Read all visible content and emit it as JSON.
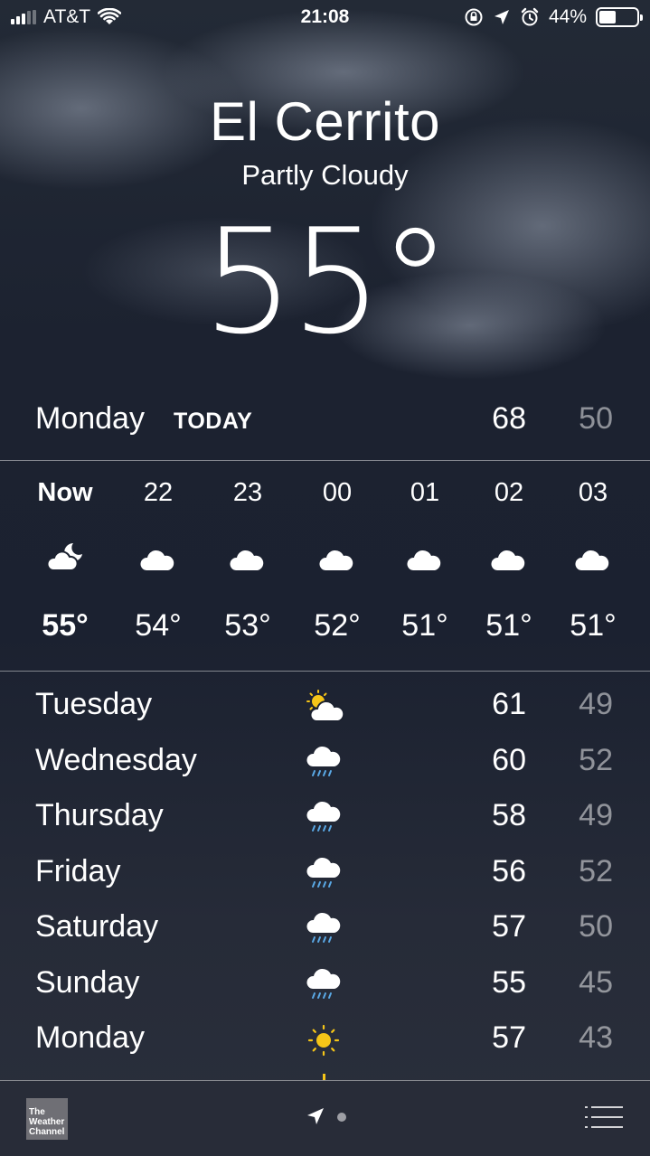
{
  "status": {
    "carrier": "AT&T",
    "time": "21:08",
    "battery": "44%",
    "battery_level": 0.44
  },
  "header": {
    "city": "El Cerrito",
    "condition": "Partly Cloudy",
    "temperature": "55°"
  },
  "today": {
    "day": "Monday",
    "tag": "TODAY",
    "high": "68",
    "low": "50"
  },
  "hourly": [
    {
      "hour": "Now",
      "icon": "partly-cloudy-night-icon",
      "temp": "55°"
    },
    {
      "hour": "22",
      "icon": "cloud-icon",
      "temp": "54°"
    },
    {
      "hour": "23",
      "icon": "cloud-icon",
      "temp": "53°"
    },
    {
      "hour": "00",
      "icon": "cloud-icon",
      "temp": "52°"
    },
    {
      "hour": "01",
      "icon": "cloud-icon",
      "temp": "51°"
    },
    {
      "hour": "02",
      "icon": "cloud-icon",
      "temp": "51°"
    },
    {
      "hour": "03",
      "icon": "cloud-icon",
      "temp": "51°"
    }
  ],
  "daily": [
    {
      "day": "Tuesday",
      "icon": "partly-sunny-icon",
      "high": "61",
      "low": "49"
    },
    {
      "day": "Wednesday",
      "icon": "rain-icon",
      "high": "60",
      "low": "52"
    },
    {
      "day": "Thursday",
      "icon": "rain-icon",
      "high": "58",
      "low": "49"
    },
    {
      "day": "Friday",
      "icon": "rain-icon",
      "high": "56",
      "low": "52"
    },
    {
      "day": "Saturday",
      "icon": "rain-icon",
      "high": "57",
      "low": "50"
    },
    {
      "day": "Sunday",
      "icon": "rain-icon",
      "high": "55",
      "low": "45"
    },
    {
      "day": "Monday",
      "icon": "sun-icon",
      "high": "57",
      "low": "43"
    }
  ],
  "footer": {
    "brand_line1": "The",
    "brand_line2": "Weather",
    "brand_line3": "Channel"
  },
  "colors": {
    "sun": "#f5c518",
    "rain": "#5aa9e6",
    "low_text": "rgba(255,255,255,0.5)"
  }
}
